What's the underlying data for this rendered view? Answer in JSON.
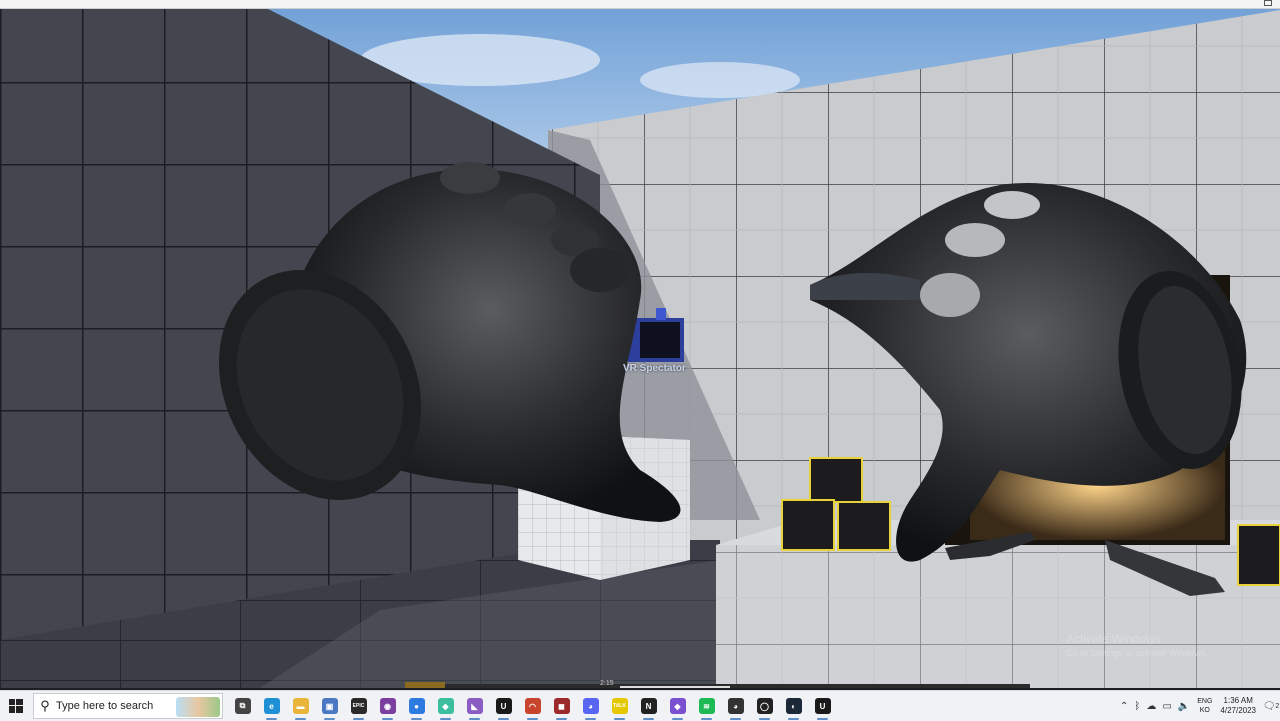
{
  "viewport": {
    "spectator_label": "VR Spectator",
    "watermark": {
      "title": "Activate Windows",
      "subtitle": "Go to Settings to activate Windows."
    },
    "video_time": "2:15"
  },
  "taskbar": {
    "start_icon": "windows-logo-icon",
    "search_placeholder": "Type here to search",
    "apps": [
      {
        "name": "task-view-icon",
        "label": "⧉",
        "color": "#444444"
      },
      {
        "name": "edge-icon",
        "label": "e",
        "color": "#1f8fd6"
      },
      {
        "name": "file-explorer-icon",
        "label": "▬",
        "color": "#e8b53a"
      },
      {
        "name": "remote-desktop-icon",
        "label": "▣",
        "color": "#4a78c2"
      },
      {
        "name": "epic-games-icon",
        "label": "EPIC",
        "color": "#2a2a2a"
      },
      {
        "name": "github-desktop-icon",
        "label": "◉",
        "color": "#7b3fa0"
      },
      {
        "name": "maps-icon",
        "label": "●",
        "color": "#2d7be0"
      },
      {
        "name": "git-kraken-icon",
        "label": "◆",
        "color": "#3bbf9e"
      },
      {
        "name": "visual-studio-icon",
        "label": "◣",
        "color": "#8a5cc4"
      },
      {
        "name": "unreal-engine-icon",
        "label": "U",
        "color": "#1a1a1a"
      },
      {
        "name": "headset-icon",
        "label": "◠",
        "color": "#c8442c"
      },
      {
        "name": "game-app-icon",
        "label": "◼",
        "color": "#9d2a2a"
      },
      {
        "name": "discord-icon",
        "label": "◕",
        "color": "#5865f2"
      },
      {
        "name": "kakaotalk-icon",
        "label": "TALK",
        "color": "#e6c800"
      },
      {
        "name": "notion-icon",
        "label": "N",
        "color": "#222222"
      },
      {
        "name": "obsidian-icon",
        "label": "◆",
        "color": "#7a4fd0"
      },
      {
        "name": "spotify-icon",
        "label": "≋",
        "color": "#1db954"
      },
      {
        "name": "davinci-icon",
        "label": "◕",
        "color": "#333333"
      },
      {
        "name": "oculus-icon",
        "label": "◯",
        "color": "#222222"
      },
      {
        "name": "steam-icon",
        "label": "◐",
        "color": "#1b2838"
      },
      {
        "name": "unreal-engine-2-icon",
        "label": "U",
        "color": "#1a1a1a"
      }
    ],
    "tray": {
      "icons": [
        {
          "name": "chevron-up-icon",
          "label": "⌃"
        },
        {
          "name": "bluetooth-icon",
          "label": "ᛒ"
        },
        {
          "name": "cloud-icon",
          "label": "☁"
        },
        {
          "name": "network-icon",
          "label": "▭"
        },
        {
          "name": "volume-icon",
          "label": "🔈"
        }
      ],
      "lang_line1": "ENG",
      "lang_line2": "KO",
      "time": "1:36 AM",
      "date": "4/27/2023",
      "notification_count": "2"
    }
  }
}
